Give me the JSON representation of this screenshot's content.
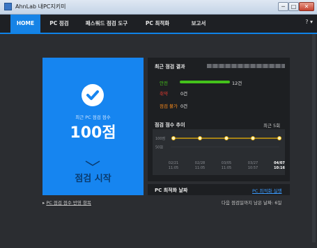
{
  "window": {
    "title": "AhnLab 내PC지키미",
    "min_label": "─",
    "max_label": "□",
    "close_label": "✕"
  },
  "nav": {
    "tabs": [
      "HOME",
      "PC 점검",
      "패스워드 점검 도구",
      "PC 최적화",
      "보고서"
    ],
    "help_label": "? ▾"
  },
  "score_card": {
    "label": "최근 PC 점검 점수",
    "score": "100점",
    "start_label": "점검 시작",
    "accent": "#1685f0"
  },
  "recent": {
    "title": "최근 점검 결과",
    "rows": [
      {
        "label": "안전",
        "value": "12건",
        "color": "#44c21b"
      },
      {
        "label": "취약",
        "value": "0건",
        "color": "#e83a2f"
      },
      {
        "label": "점검 불가",
        "value": "0건",
        "color": "#ff8c1a"
      }
    ]
  },
  "trend": {
    "title": "점검 점수 추이",
    "recent_label": "최근 5회",
    "icon": "trend-line"
  },
  "chart_data": {
    "type": "line",
    "x": [
      "02/21 11:05",
      "02/28 11:05",
      "03/05 11:05",
      "03/27 10:57",
      "04/07 10:16"
    ],
    "y": [
      100,
      100,
      100,
      100,
      100
    ],
    "ylabels": [
      "100점",
      "50점"
    ],
    "ylim": [
      0,
      120
    ],
    "series": [
      {
        "name": "",
        "values": [
          100,
          100,
          100,
          100,
          100
        ]
      }
    ]
  },
  "optimize": {
    "title": "PC 최적화 날짜",
    "run_label": "PC 최적화 실행"
  },
  "footer": {
    "left_label": "PC 점검 점수 반영 항목",
    "right_label": "다음 점검일까지 남은 날짜: 6일"
  }
}
